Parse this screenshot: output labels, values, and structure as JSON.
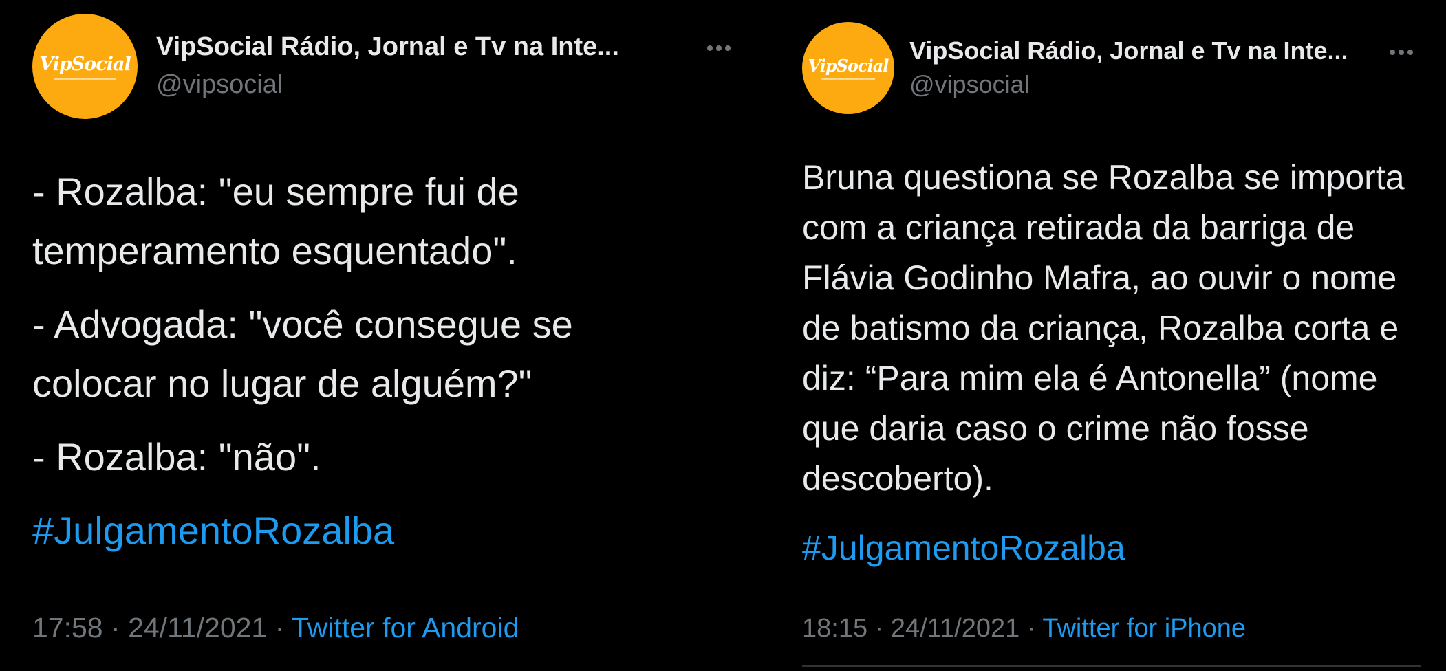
{
  "tweets": [
    {
      "author": {
        "name": "VipSocial Rádio, Jornal e Tv na Inte...",
        "handle": "@vipsocial",
        "avatar_text": "VipSocial"
      },
      "body": [
        "- Rozalba: \"eu sempre fui de temperamento esquentado\".",
        "- Advogada: \"você consegue se colocar no lugar de alguém?\"",
        "- Rozalba: \"não\"."
      ],
      "hashtag": "#JulgamentoRozalba",
      "time": "17:58",
      "date": "24/11/2021",
      "source": "Twitter for Android",
      "separator": "·"
    },
    {
      "author": {
        "name": "VipSocial Rádio, Jornal e Tv na Inte...",
        "handle": "@vipsocial",
        "avatar_text": "VipSocial"
      },
      "body": [
        "Bruna questiona se Rozalba se importa com a criança retirada da barriga de Flávia Godinho Mafra, ao ouvir o nome de batismo da criança, Rozalba corta e diz: “Para mim ela é Antonella” (nome que daria caso o crime não fosse descoberto)."
      ],
      "hashtag": "#JulgamentoRozalba",
      "time": "18:15",
      "date": "24/11/2021",
      "source": "Twitter for iPhone",
      "separator": "·"
    }
  ],
  "colors": {
    "background": "#000000",
    "text": "#e7e9ea",
    "muted": "#71767b",
    "link": "#1d9bf0",
    "avatar": "#fcaa10"
  }
}
